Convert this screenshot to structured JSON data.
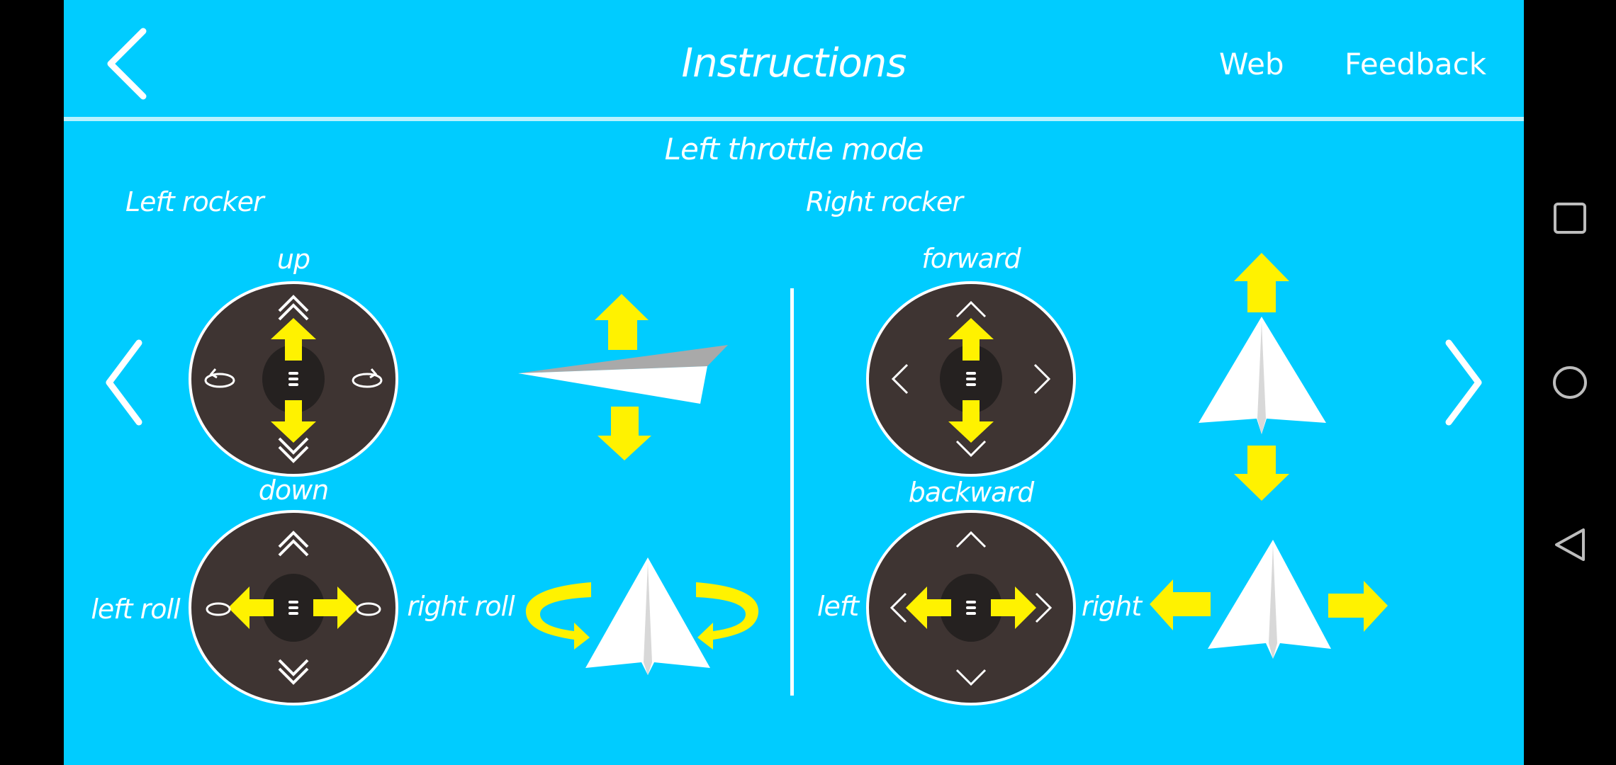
{
  "header": {
    "title": "Instructions",
    "back_icon": "chevron-left-icon",
    "links": [
      {
        "label": "Web"
      },
      {
        "label": "Feedback"
      }
    ]
  },
  "content": {
    "mode_title": "Left throttle mode",
    "left_rocker": {
      "label": "Left rocker",
      "up_label": "up",
      "down_label": "down",
      "left_roll_label": "left roll",
      "right_roll_label": "right roll"
    },
    "right_rocker": {
      "label": "Right rocker",
      "forward_label": "forward",
      "backward_label": "backward",
      "left_label": "left",
      "right_label": "right"
    },
    "prev_icon": "chevron-left-icon",
    "next_icon": "chevron-right-icon"
  },
  "colors": {
    "background": "#00CCFF",
    "arrow_yellow": "#FFF200",
    "joystick": "#3E3432",
    "text": "#FFFFFF"
  },
  "system_nav": {
    "recents_icon": "square-icon",
    "home_icon": "circle-icon",
    "back_icon": "triangle-back-icon"
  }
}
